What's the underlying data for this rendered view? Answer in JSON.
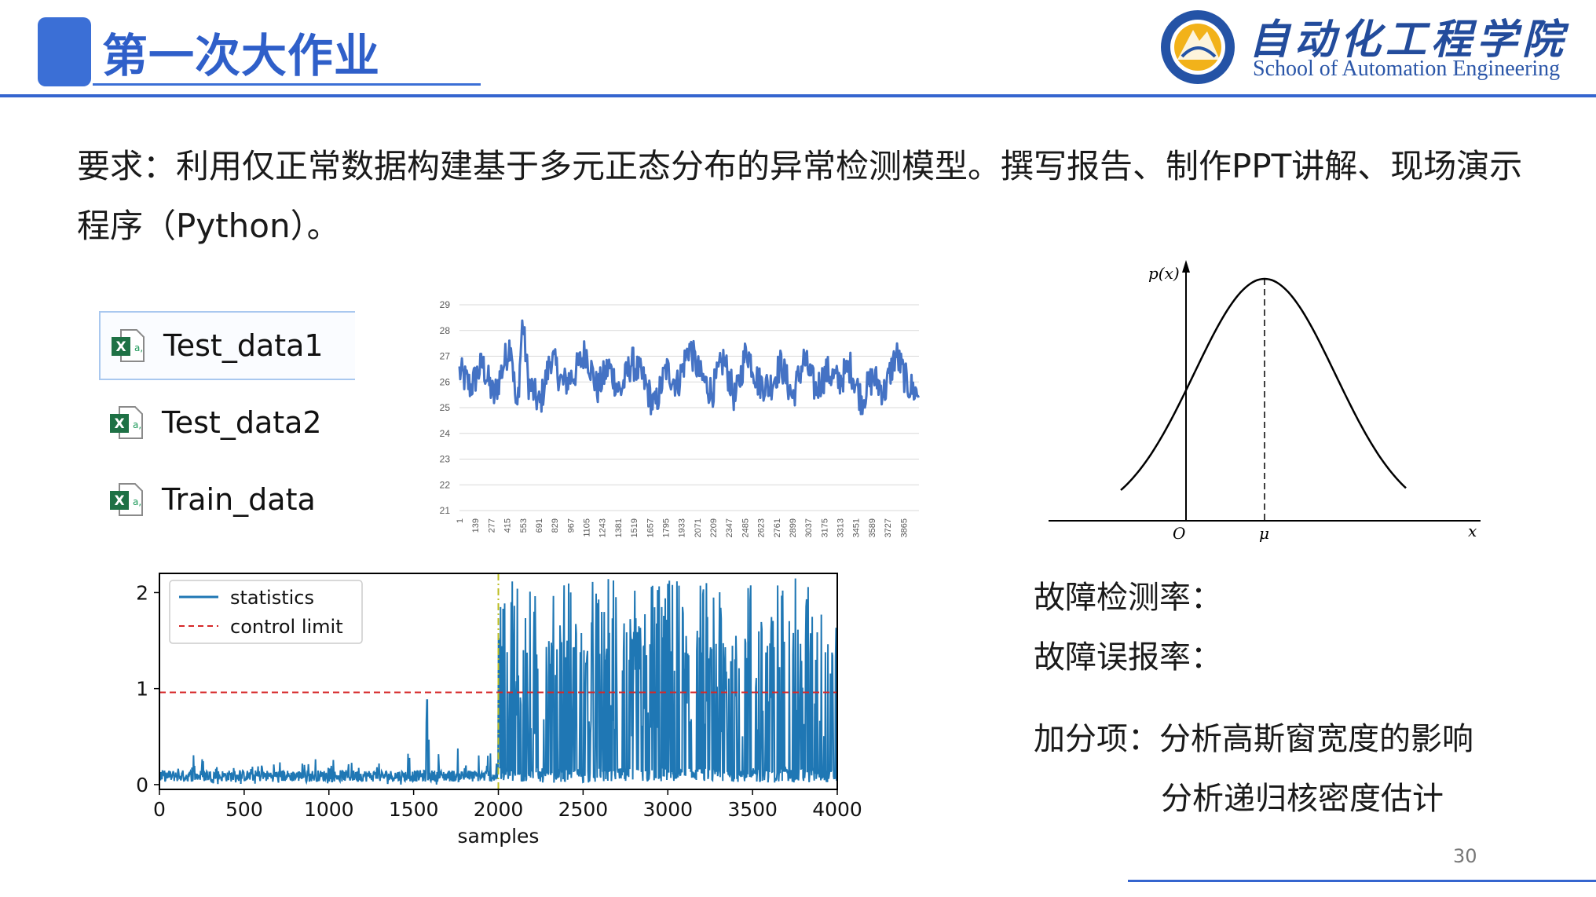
{
  "header": {
    "title": "第一次大作业",
    "logo_title": "自动化工程学院",
    "logo_subtitle": "School of Automation Engineering"
  },
  "requirement": {
    "line1": "要求：利用仅正常数据构建基于多元正态分布的异常检测模型。撰写报告、制作PPT讲解、现场演示",
    "line2": "程序（Python）。"
  },
  "files": [
    {
      "name": "Test_data1",
      "icon": "excel-file-icon"
    },
    {
      "name": "Test_data2",
      "icon": "excel-file-icon"
    },
    {
      "name": "Train_data",
      "icon": "excel-file-icon"
    }
  ],
  "right_text": {
    "fault_detection_rate": "故障检测率：",
    "fault_false_alarm_rate": "故障误报率：",
    "bonus_line1": "加分项：分析高斯窗宽度的影响",
    "bonus_line2": "分析递归核密度估计"
  },
  "page_number": "30",
  "colors": {
    "accent": "#3b6fd6",
    "series_blue": "#4472c4",
    "statistics_blue": "#1f77b4",
    "control_limit_red": "#d62728",
    "divider_olive": "#bcbd22"
  },
  "chart_data": [
    {
      "type": "line",
      "title": "",
      "xlabel": "",
      "ylabel": "",
      "ylim": [
        21,
        29
      ],
      "yticks": [
        21,
        22,
        23,
        24,
        25,
        26,
        27,
        28,
        29
      ],
      "xticks": [
        1,
        139,
        277,
        415,
        553,
        691,
        829,
        967,
        1105,
        1243,
        1381,
        1519,
        1657,
        1795,
        1933,
        2071,
        2209,
        2347,
        2485,
        2623,
        2761,
        2899,
        3037,
        3175,
        3313,
        3451,
        3589,
        3727,
        3865
      ],
      "xlim": [
        1,
        4000
      ],
      "grid": true,
      "series": [
        {
          "color": "#4472c4",
          "x": [
            1,
            100,
            200,
            300,
            400,
            450,
            500,
            550,
            600,
            700,
            800,
            900,
            1000,
            1100,
            1200,
            1300,
            1400,
            1500,
            1600,
            1700,
            1800,
            1900,
            2000,
            2100,
            2200,
            2300,
            2400,
            2500,
            2600,
            2700,
            2800,
            2900,
            3000,
            3100,
            3200,
            3300,
            3400,
            3500,
            3600,
            3700,
            3800,
            3900,
            4000
          ],
          "values": [
            26.4,
            25.8,
            26.7,
            25.4,
            26.9,
            27.6,
            24.6,
            28.4,
            26.0,
            25.1,
            27.0,
            25.9,
            26.3,
            27.2,
            25.7,
            26.6,
            25.6,
            26.8,
            26.1,
            25.0,
            26.5,
            25.9,
            27.4,
            26.2,
            25.6,
            26.9,
            25.3,
            27.3,
            26.0,
            25.8,
            26.7,
            25.4,
            26.9,
            25.7,
            26.4,
            26.0,
            26.6,
            25.3,
            26.2,
            25.6,
            27.1,
            25.9,
            25.5
          ]
        }
      ]
    },
    {
      "type": "line",
      "title": "",
      "xlabel": "samples",
      "ylabel": "",
      "xlim": [
        0,
        4000
      ],
      "ylim": [
        -0.05,
        2.2
      ],
      "xticks": [
        0,
        500,
        1000,
        1500,
        2000,
        2500,
        3000,
        3500,
        4000
      ],
      "yticks": [
        0,
        1,
        2
      ],
      "legend_position": "top-left",
      "series": [
        {
          "name": "statistics",
          "color": "#1f77b4",
          "x": [
            0,
            100,
            200,
            300,
            400,
            500,
            600,
            700,
            800,
            900,
            1000,
            1100,
            1200,
            1300,
            1400,
            1500,
            1580,
            1600,
            1700,
            1800,
            1900,
            1999,
            2000,
            2050,
            2100,
            2200,
            2300,
            2400,
            2500,
            2600,
            2700,
            2800,
            2900,
            3000,
            3100,
            3200,
            3300,
            3400,
            3500,
            3600,
            3700,
            3800,
            3900,
            4000
          ],
          "values": [
            0.15,
            0.22,
            0.35,
            0.18,
            0.25,
            0.12,
            0.3,
            0.2,
            0.45,
            0.28,
            0.2,
            0.38,
            0.22,
            0.4,
            0.3,
            0.35,
            0.88,
            0.25,
            0.42,
            0.3,
            0.38,
            0.3,
            1.45,
            2.15,
            1.2,
            2.1,
            1.6,
            2.1,
            1.3,
            2.15,
            1.1,
            2.1,
            1.7,
            2.15,
            1.25,
            2.1,
            1.4,
            2.15,
            1.0,
            2.1,
            1.5,
            2.15,
            1.2,
            2.15
          ]
        },
        {
          "name": "control limit",
          "color": "#d62728",
          "style": "dashed",
          "constant": 0.96
        }
      ],
      "vertical_line": {
        "x": 2000,
        "color": "#bcbd22",
        "style": "dashdot"
      }
    },
    {
      "type": "line",
      "title": "",
      "xlabel": "x",
      "ylabel": "p(x)",
      "x_annotations": [
        "O",
        "μ"
      ],
      "series": [
        {
          "distribution": "normal",
          "mean_label": "μ"
        }
      ]
    }
  ]
}
